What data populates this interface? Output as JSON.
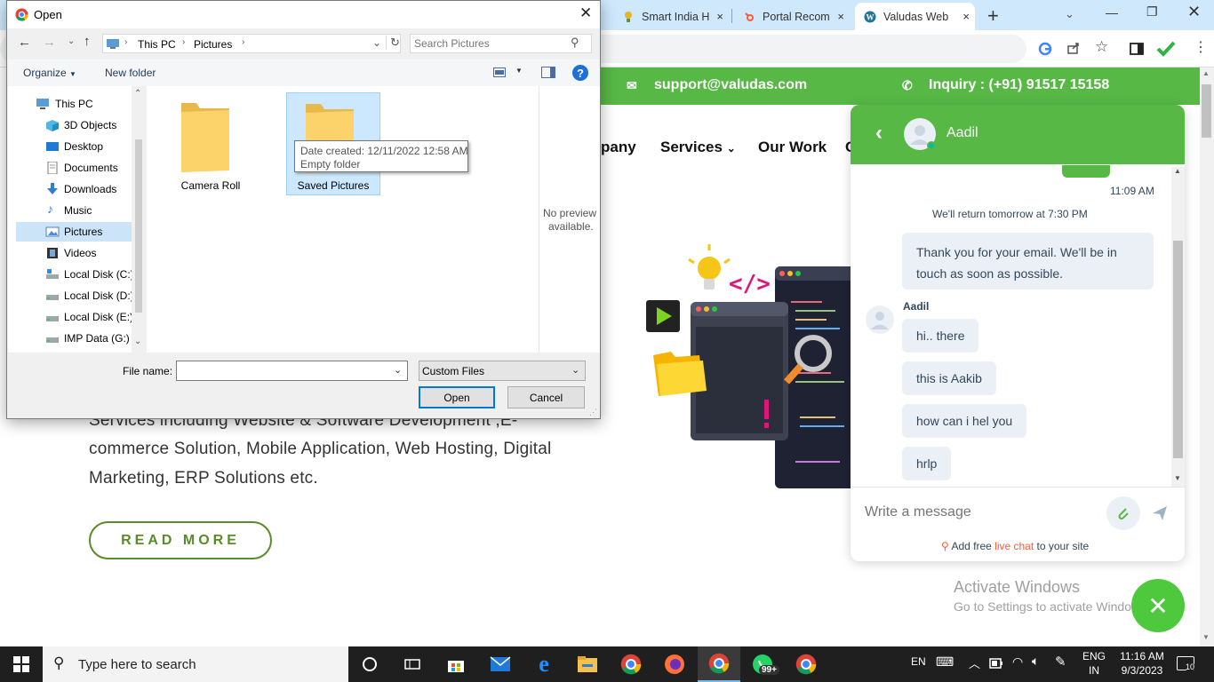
{
  "browser": {
    "tabs": [
      {
        "label": "Smart India H",
        "close": "×"
      },
      {
        "label": "Portal Recom",
        "close": "×"
      },
      {
        "label": "Valudas Web",
        "close": "×"
      }
    ],
    "new_tab": "+"
  },
  "website": {
    "support_email": "support@valudas.com",
    "inquiry": "Inquiry : (+91) 91517 15158",
    "nav": [
      "pany",
      "Services",
      "Our Work",
      "C"
    ],
    "body_lines": [
      "Services including Website & Software Development ,E-",
      "commerce Solution, Mobile Application, Web Hosting, Digital",
      "Marketing, ERP Solutions etc."
    ],
    "read_more": "READ MORE",
    "watermark_title": "Activate Windows",
    "watermark_sub": "Go to Settings to activate Windows."
  },
  "chat": {
    "agent_name": "Aadil",
    "time_stamp": "11:09 AM",
    "return_note": "We'll return tomorrow at 7:30 PM",
    "auto_reply": [
      "Thank you for your email. We'll be in",
      "touch as soon as possible."
    ],
    "sender_label": "Aadil",
    "messages": [
      "hi.. there",
      "this is Aakib",
      "how can i hel you",
      "hrlp"
    ],
    "input_placeholder": "Write a message",
    "footer_prefix": "Add free ",
    "footer_link": "live chat",
    "footer_suffix": " to your site",
    "accent_color": "#57b846"
  },
  "dialog": {
    "title": "Open",
    "breadcrumb": [
      "This PC",
      "Pictures"
    ],
    "search_placeholder": "Search Pictures",
    "organize": "Organize",
    "new_folder": "New folder",
    "nav_items": [
      "This PC",
      "3D Objects",
      "Desktop",
      "Documents",
      "Downloads",
      "Music",
      "Pictures",
      "Videos",
      "Local Disk (C:)",
      "Local Disk (D:)",
      "Local Disk (E:)",
      "IMP Data (G:)"
    ],
    "selected_nav": "Pictures",
    "folders": [
      "Camera Roll",
      "Saved Pictures"
    ],
    "tooltip_line1": "Date created: 12/11/2022 12:58 AM",
    "tooltip_line2": "Empty folder",
    "no_preview_1": "No preview",
    "no_preview_2": "available.",
    "file_name_label": "File name:",
    "file_name_value": "",
    "file_type": "Custom Files",
    "open_button": "Open",
    "cancel_button": "Cancel"
  },
  "taskbar": {
    "search_placeholder": "Type here to search",
    "whatsapp_badge": "99+",
    "lang_top": "ENG",
    "lang_bottom": "IN",
    "lang_indicator": "EN",
    "time": "11:16 AM",
    "date": "9/3/2023",
    "notification_count": "10"
  }
}
